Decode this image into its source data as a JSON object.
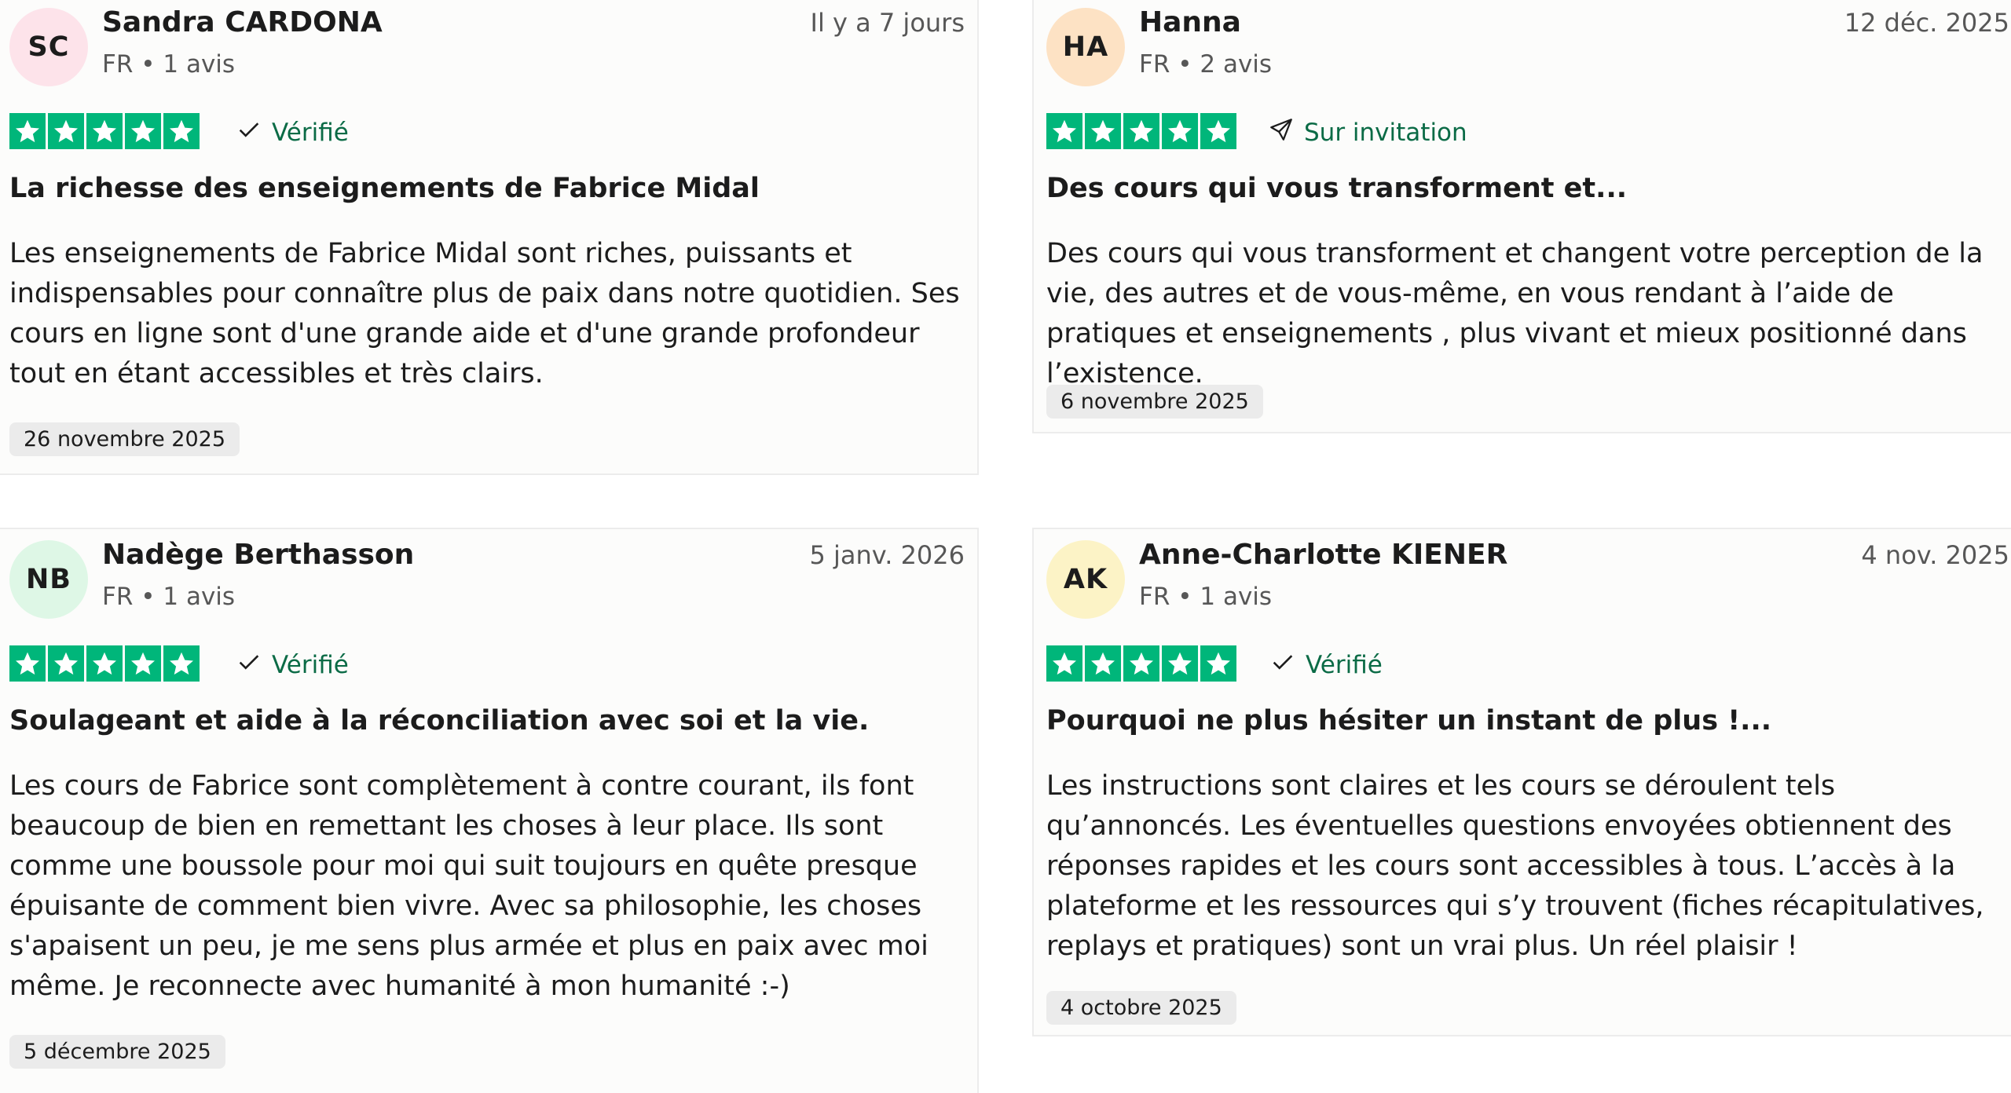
{
  "reviews": [
    {
      "initials": "SC",
      "avatar_color": "#fde3ea",
      "name": "Sandra CARDONA",
      "meta": "FR • 1 avis",
      "date": "Il y a 7 jours",
      "rating": 5,
      "badge": {
        "icon": "check-icon",
        "label": "Vérifié"
      },
      "title": "La richesse des enseignements de Fabrice Midal",
      "body": "Les enseignements de Fabrice Midal sont riches, puissants et indispensables pour connaître plus de paix dans notre quotidien. Ses cours en ligne sont d'une grande aide et d'une grande profondeur tout en étant accessibles et très clairs.",
      "experience_date": "26 novembre 2025"
    },
    {
      "initials": "HA",
      "avatar_color": "#fde2c4",
      "name": "Hanna",
      "meta": "FR • 2 avis",
      "date": "12 déc. 2025",
      "rating": 5,
      "badge": {
        "icon": "send-icon",
        "label": "Sur invitation"
      },
      "title": "Des cours qui vous transforment et...",
      "body": "Des cours qui vous transforment et changent votre perception de la vie, des autres et de vous-même, en vous rendant à l’aide de pratiques et enseignements , plus vivant et mieux positionné dans l’existence.",
      "experience_date": "6 novembre 2025"
    },
    {
      "initials": "NB",
      "avatar_color": "#def7e6",
      "name": "Nadège Berthasson",
      "meta": "FR • 1 avis",
      "date": "5 janv. 2026",
      "rating": 5,
      "badge": {
        "icon": "check-icon",
        "label": "Vérifié"
      },
      "title": "Soulageant et aide à la réconciliation avec soi et la vie.",
      "body": "Les cours de Fabrice sont complètement à contre courant, ils font beaucoup de bien en remettant les choses à leur place. Ils sont comme une boussole pour moi qui suit toujours en quête presque épuisante de comment bien vivre. Avec sa philosophie, les choses s'apaisent un peu, je me sens plus armée et plus en paix avec moi même. Je reconnecte avec humanité à mon humanité :-)",
      "experience_date": "5 décembre 2025"
    },
    {
      "initials": "AK",
      "avatar_color": "#fcf3c6",
      "name": "Anne-Charlotte KIENER",
      "meta": "FR • 1 avis",
      "date": "4 nov. 2025",
      "rating": 5,
      "badge": {
        "icon": "check-icon",
        "label": "Vérifié"
      },
      "title": "Pourquoi ne plus hésiter un instant de plus !...",
      "body": "Les instructions sont claires et les cours se déroulent tels qu’annoncés. Les éventuelles questions envoyées obtiennent des réponses rapides et les cours sont accessibles à tous. L’accès à la plateforme et les ressources qui s’y trouvent (fiches récapitulatives, replays et pratiques) sont un vrai plus. Un réel plaisir !",
      "experience_date": "4 octobre 2025"
    }
  ],
  "colors": {
    "star_green": "#00b67a",
    "badge_green": "#0b6b46"
  }
}
